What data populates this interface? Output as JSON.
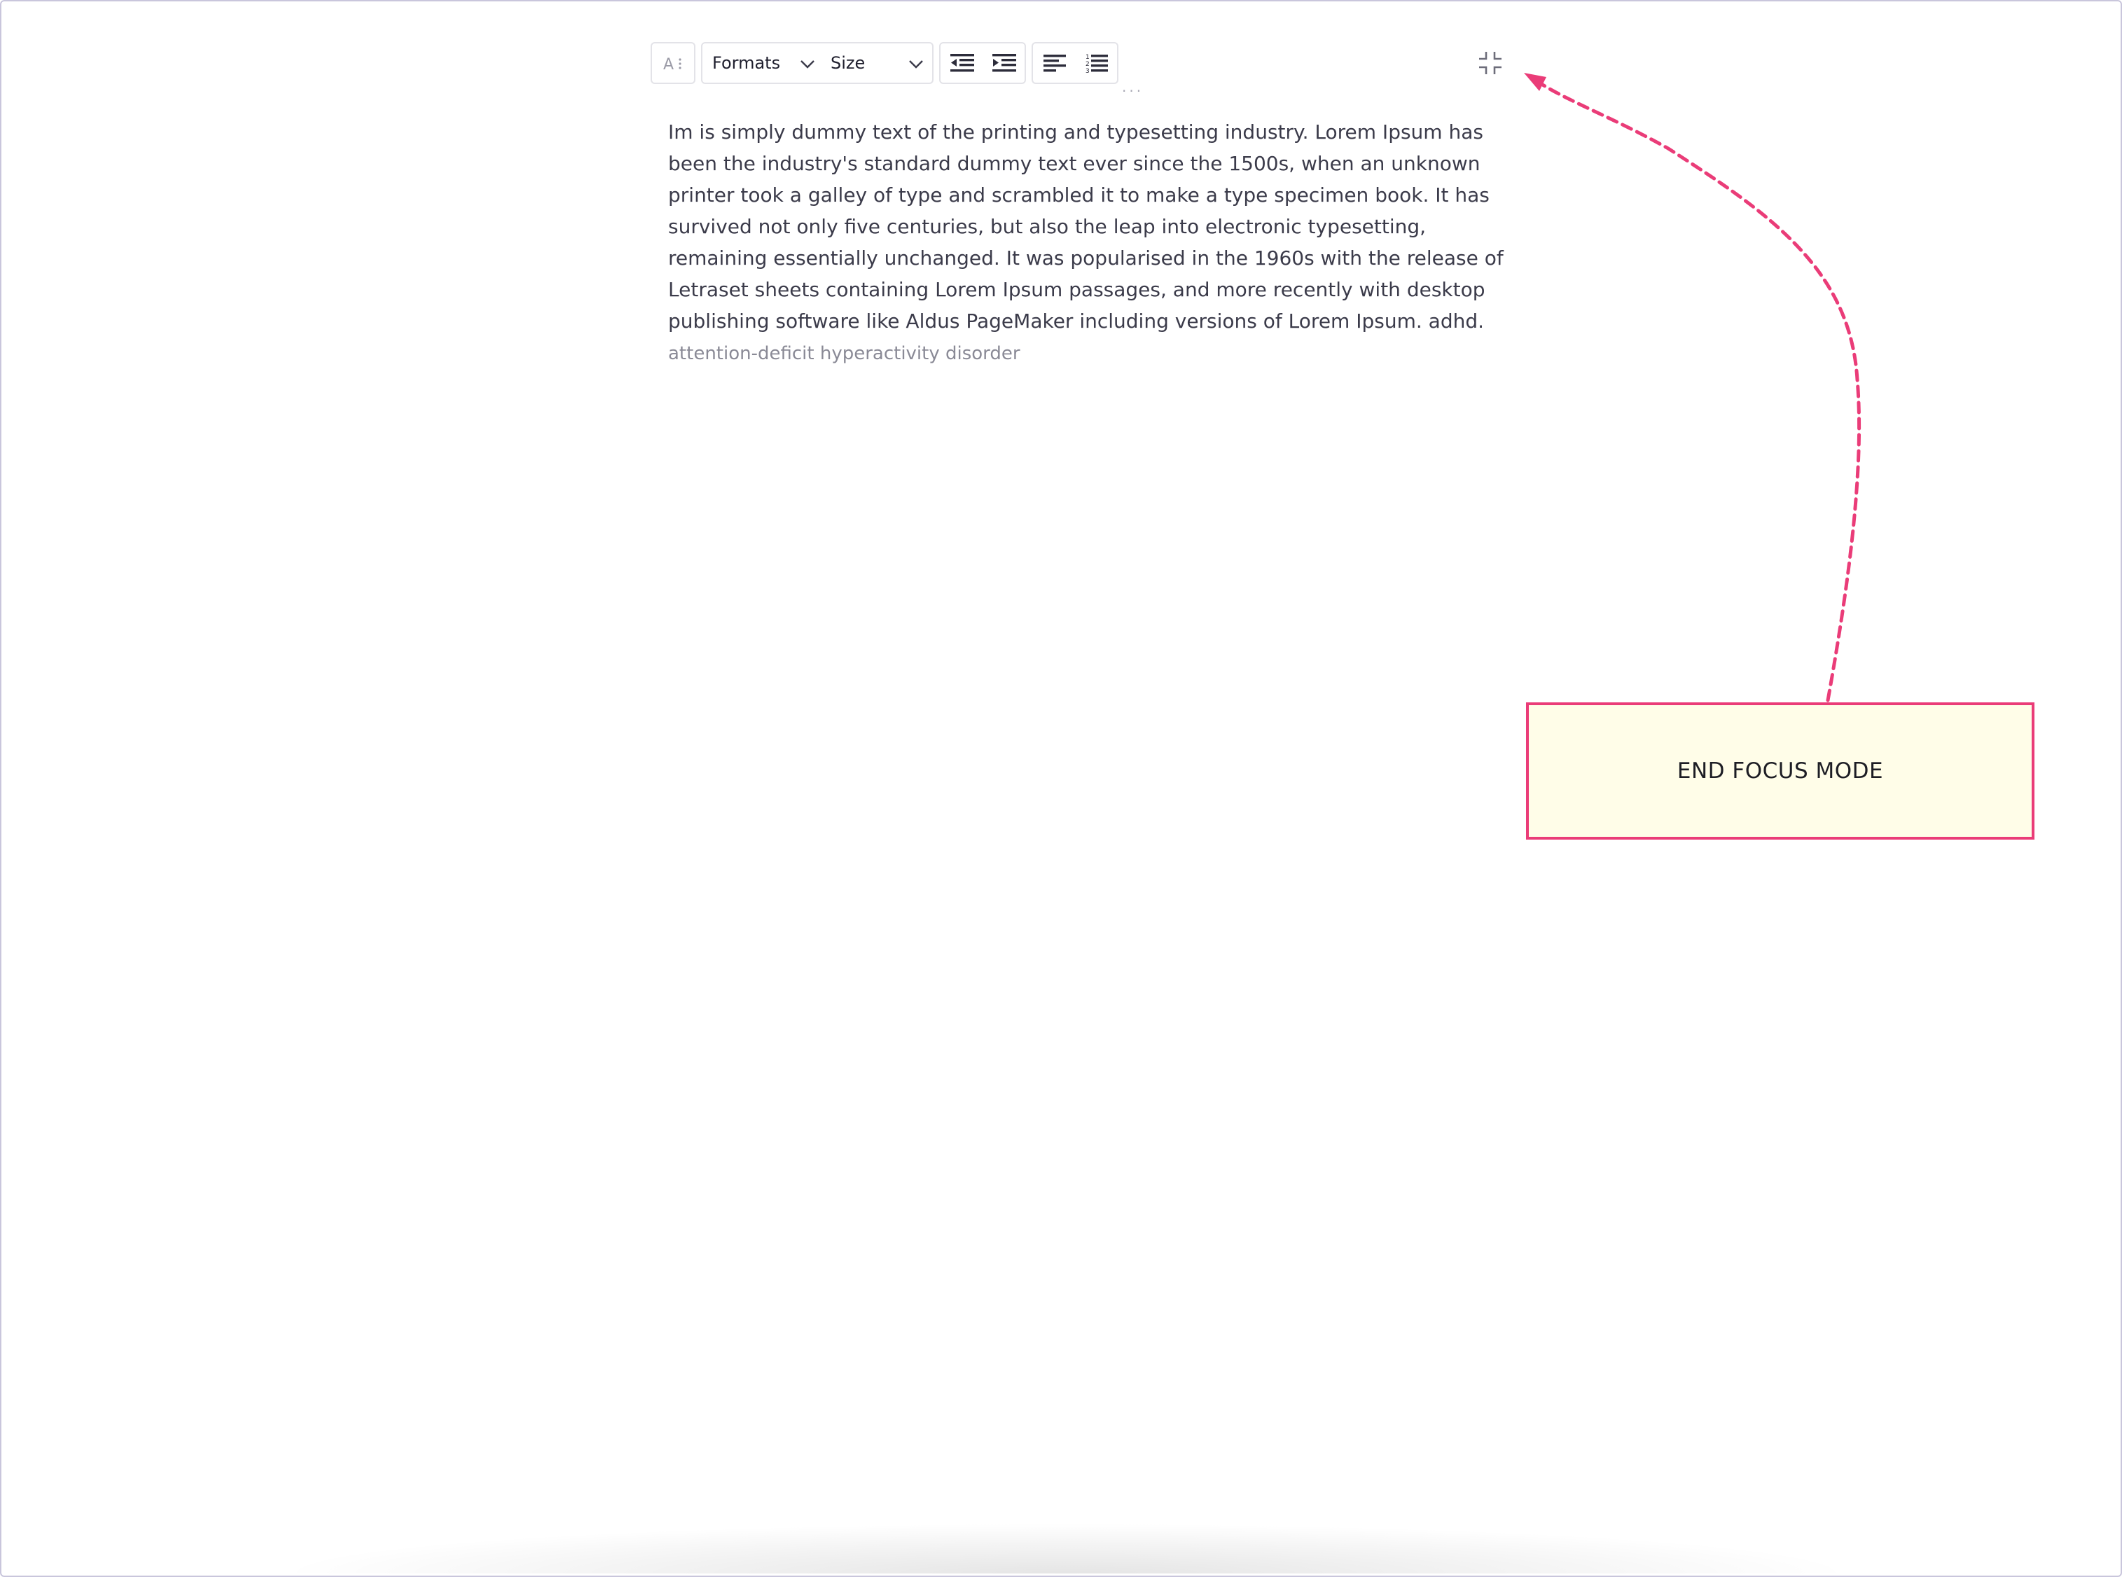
{
  "toolbar": {
    "font_button_label": "A",
    "formats_label": "Formats",
    "size_label": "Size",
    "more_label": "...",
    "icons": {
      "font": "font-settings-icon",
      "formats": "chevron-down-icon",
      "size": "chevron-down-icon",
      "outdent": "outdent-icon",
      "indent": "indent-icon",
      "align_left": "align-left-icon",
      "ordered_list": "ordered-list-icon",
      "collapse": "collapse-fullscreen-icon"
    }
  },
  "editor": {
    "body_text": "Im is simply dummy text of the printing and typesetting industry. Lorem Ipsum has been the industry's standard dummy text ever since the 1500s, when an unknown printer took a galley of type and scrambled it to make a type specimen book. It has survived not only five centuries, but also the leap into electronic typesetting, remaining essentially unchanged. It was popularised in the 1960s with the release of Letraset sheets containing Lorem Ipsum passages, and more recently with desktop publishing software like Aldus PageMaker including versions of Lorem Ipsum. adhd.",
    "suggestion_text": "attention-deficit hyperactivity disorder"
  },
  "annotation": {
    "label": "END FOCUS MODE"
  },
  "colors": {
    "annotation_accent": "#ea3c78",
    "annotation_fill": "#fffde8",
    "text": "#3b3b4a",
    "ghost_text": "#8a8a96"
  }
}
